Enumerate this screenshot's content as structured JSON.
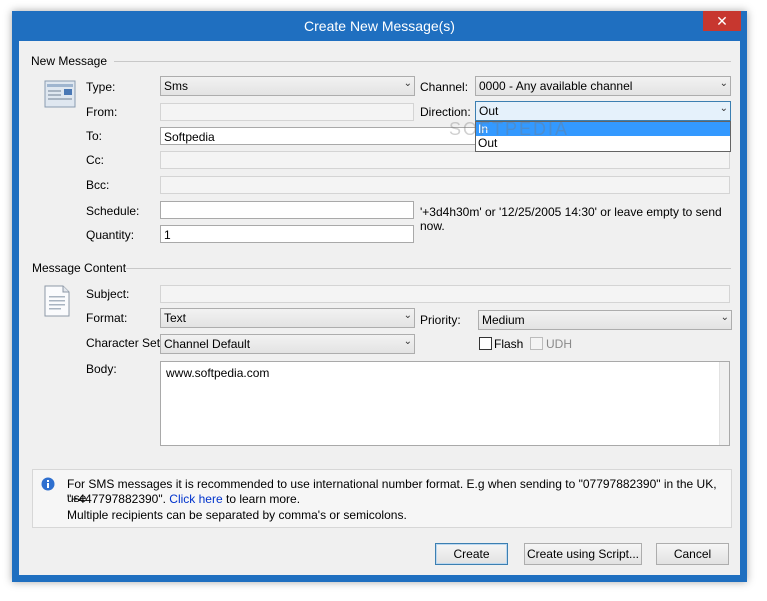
{
  "window": {
    "title": "Create New Message(s)",
    "close_glyph": "✕"
  },
  "new_message": {
    "section_title": "New Message",
    "icon": "message-window-icon",
    "type": {
      "label": "Type:",
      "value": "Sms"
    },
    "from": {
      "label": "From:",
      "value": ""
    },
    "to": {
      "label": "To:",
      "value": "Softpedia"
    },
    "cc": {
      "label": "Cc:",
      "value": ""
    },
    "bcc": {
      "label": "Bcc:",
      "value": ""
    },
    "schedule": {
      "label": "Schedule:",
      "value": "",
      "hint": "'+3d4h30m' or '12/25/2005 14:30' or leave empty to send now."
    },
    "quantity": {
      "label": "Quantity:",
      "value": "1"
    },
    "channel": {
      "label": "Channel:",
      "value": "0000 - Any available channel"
    },
    "direction": {
      "label": "Direction:",
      "value": "Out",
      "options": [
        "In",
        "Out"
      ],
      "highlighted": "In"
    }
  },
  "message_content": {
    "section_title": "Message Content",
    "icon": "document-icon",
    "subject": {
      "label": "Subject:",
      "value": ""
    },
    "format": {
      "label": "Format:",
      "value": "Text"
    },
    "character_set": {
      "label": "Character Set:",
      "value": "Channel Default"
    },
    "priority": {
      "label": "Priority:",
      "value": "Medium"
    },
    "flash": {
      "label": "Flash",
      "checked": false
    },
    "udh": {
      "label": "UDH",
      "checked": false,
      "enabled": false
    },
    "body": {
      "label": "Body:",
      "value": "www.softpedia.com"
    }
  },
  "info": {
    "icon": "info-icon",
    "line1": "For SMS messages it is recommended to use international number format. E.g when sending to \"07797882390\" in the UK, use",
    "line2_prefix": "\"+447797882390\".",
    "link": "Click here",
    "line2_suffix": "to learn more.",
    "line3": "Multiple recipients can be separated by comma's or semicolons."
  },
  "buttons": {
    "create": "Create",
    "create_script": "Create using Script...",
    "cancel": "Cancel"
  },
  "watermark": "SOFTPEDIA"
}
